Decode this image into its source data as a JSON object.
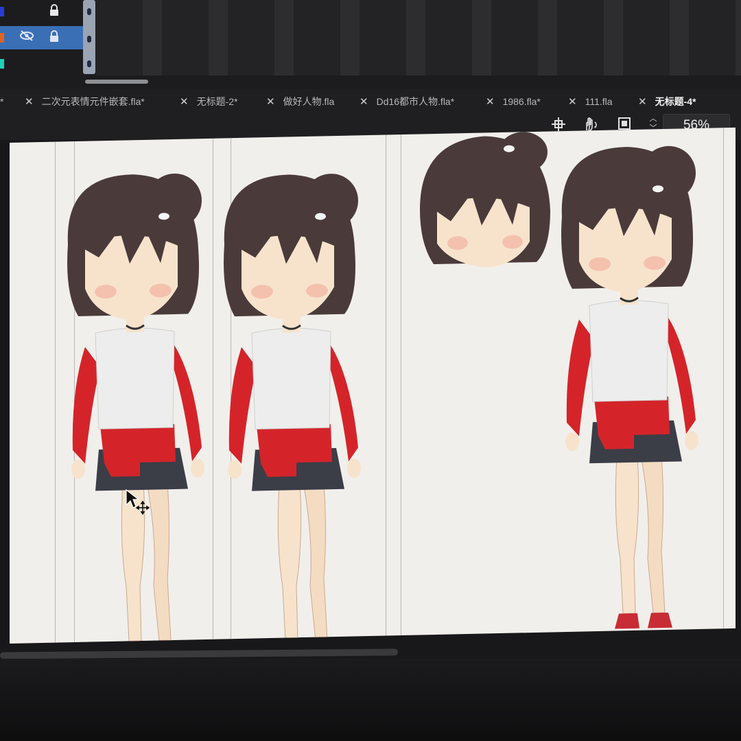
{
  "layers": [
    {
      "color": "#2a3bd6",
      "visible": true,
      "locked": true,
      "selected": false
    },
    {
      "color": "#e2621f",
      "visible": false,
      "locked": true,
      "selected": true
    },
    {
      "color": "#1fd0b8",
      "visible": true,
      "locked": false,
      "selected": false
    }
  ],
  "tabs": [
    {
      "label": "*"
    },
    {
      "label": "二次元表情元件嵌套.fla*"
    },
    {
      "label": "无标题-2*"
    },
    {
      "label": "做好人物.fla"
    },
    {
      "label": "Dd16都市人物.fla*"
    },
    {
      "label": "1986.fla*"
    },
    {
      "label": "111.fla"
    },
    {
      "label": "无标题-4*",
      "active": true
    }
  ],
  "toolbar": {
    "icons": [
      "center-stage-icon",
      "rotate-hand-icon",
      "clip-canvas-icon"
    ],
    "zoom": "56%"
  },
  "colors": {
    "stage_bg": "#f1efeb",
    "hair": "#4a3b3a",
    "shirt_red": "#d4242a",
    "shirt_white": "#ededed",
    "skirt": "#3b3d47",
    "skin": "#f7e3cc",
    "blush": "#f2b8a8"
  }
}
